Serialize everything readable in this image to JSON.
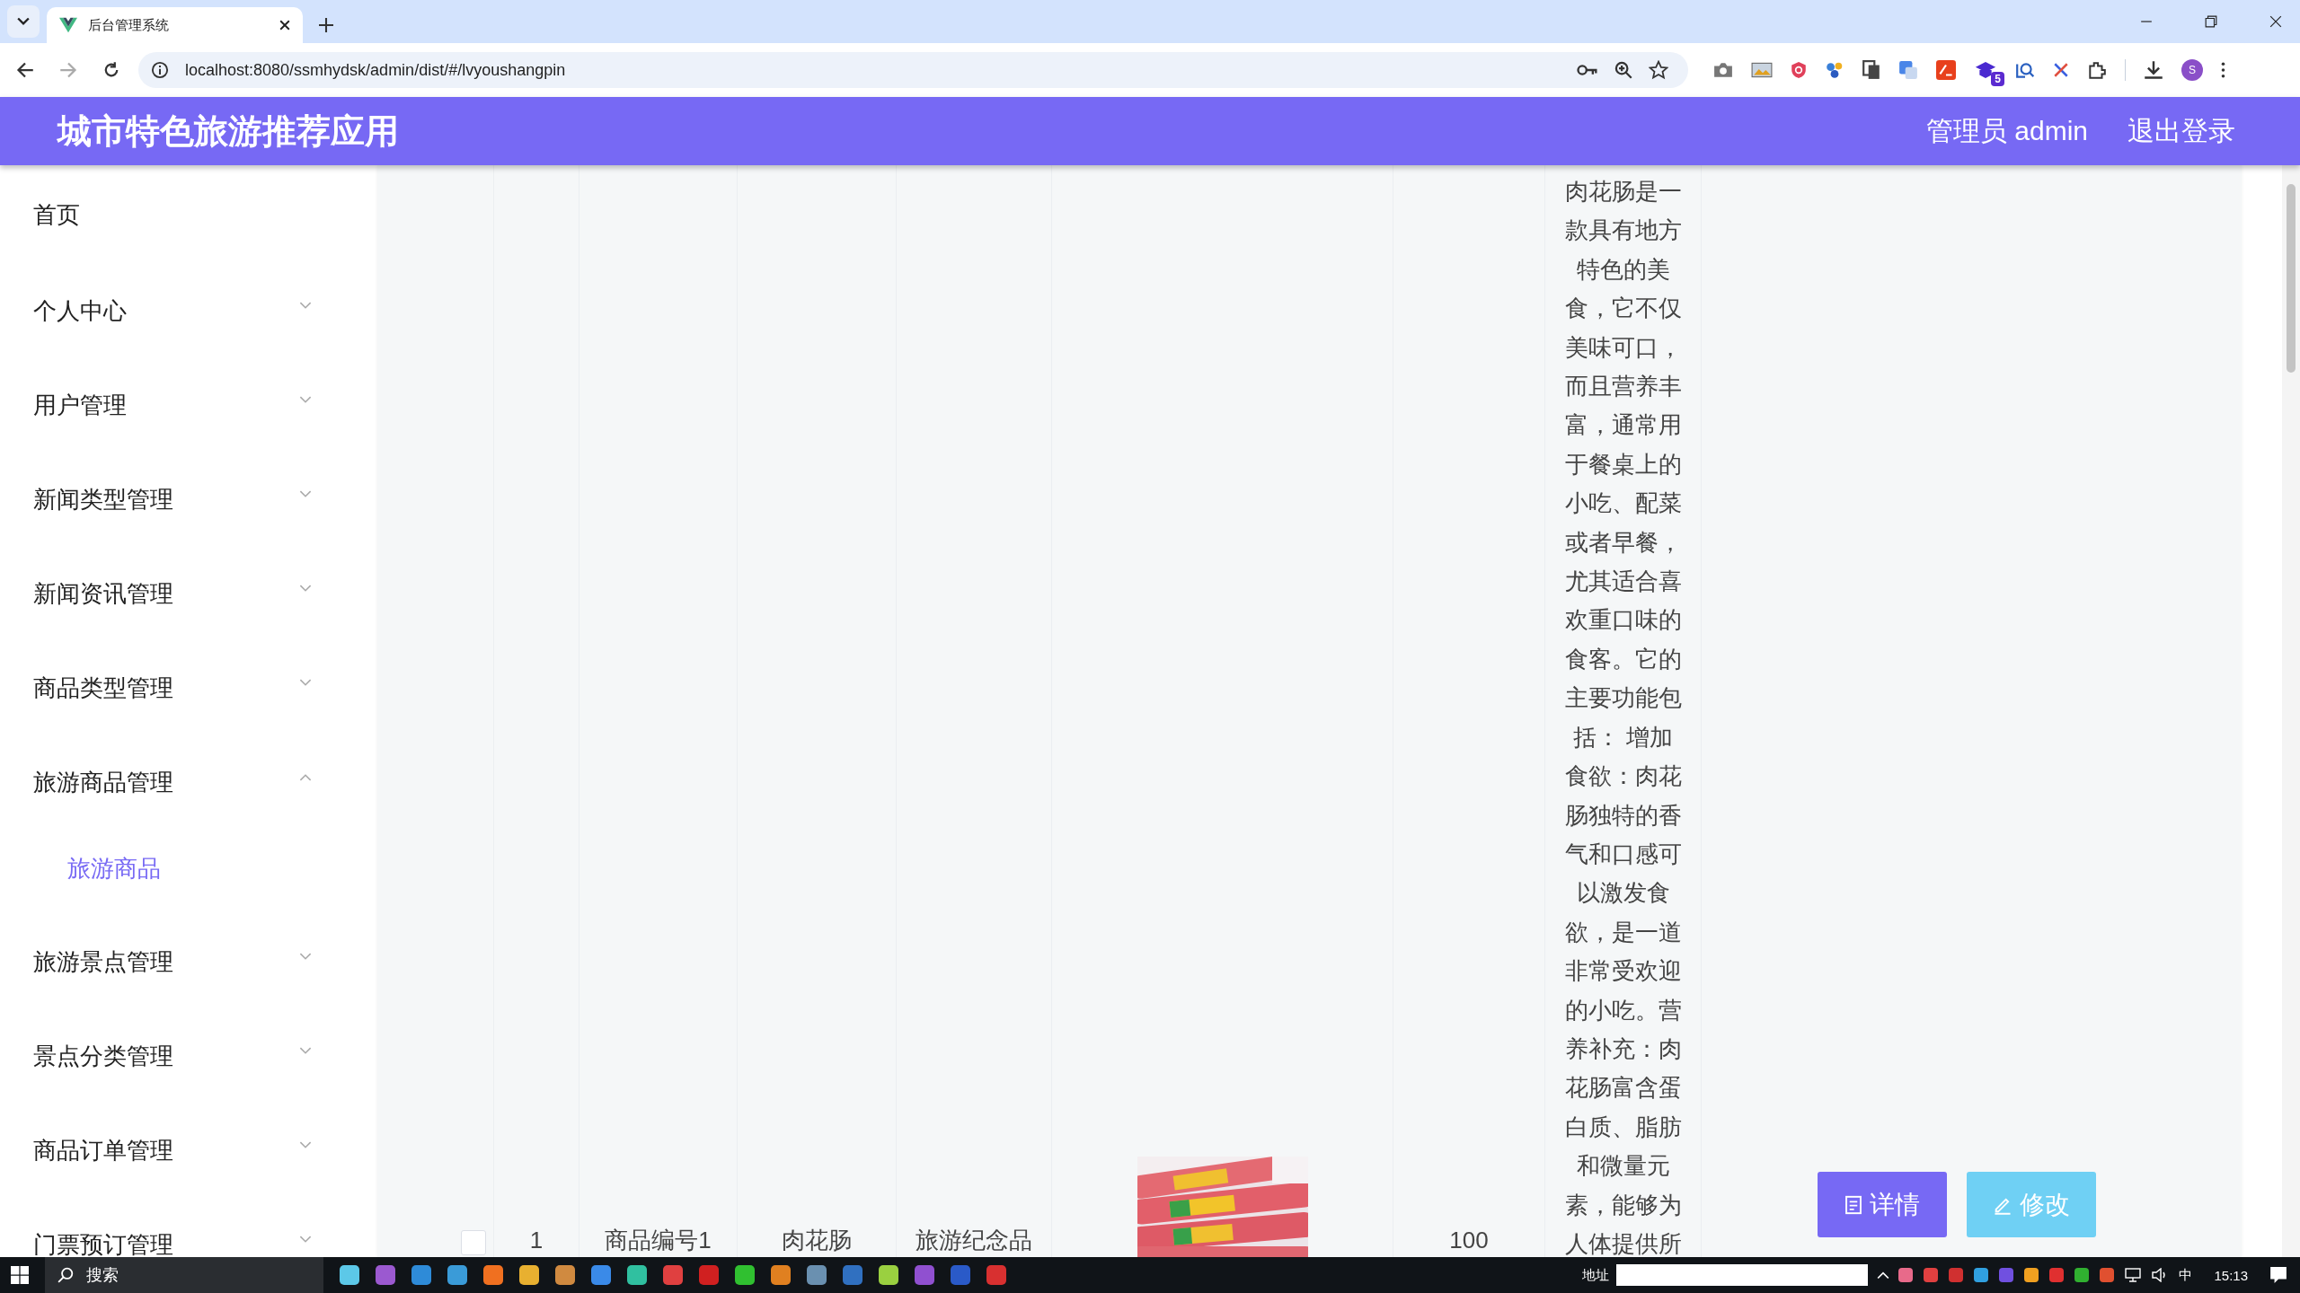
{
  "browser": {
    "tab": {
      "title": "后台管理系统"
    },
    "url": "localhost:8080/ssmhydsk/admin/dist/#/lvyoushangpin",
    "extension_badge": "5",
    "profile_initial": "S"
  },
  "header": {
    "title": "城市特色旅游推荐应用",
    "user": "管理员 admin",
    "logout": "退出登录"
  },
  "sidebar": {
    "items": [
      {
        "label": "首页",
        "kind": "link"
      },
      {
        "label": "个人中心",
        "kind": "group",
        "expanded": false
      },
      {
        "label": "用户管理",
        "kind": "group",
        "expanded": false
      },
      {
        "label": "新闻类型管理",
        "kind": "group",
        "expanded": false
      },
      {
        "label": "新闻资讯管理",
        "kind": "group",
        "expanded": false
      },
      {
        "label": "商品类型管理",
        "kind": "group",
        "expanded": false
      },
      {
        "label": "旅游商品管理",
        "kind": "group",
        "expanded": true,
        "children": [
          {
            "label": "旅游商品",
            "selected": true
          }
        ]
      },
      {
        "label": "旅游景点管理",
        "kind": "group",
        "expanded": false
      },
      {
        "label": "景点分类管理",
        "kind": "group",
        "expanded": false
      },
      {
        "label": "商品订单管理",
        "kind": "group",
        "expanded": false
      },
      {
        "label": "门票预订管理",
        "kind": "group",
        "expanded": false
      }
    ]
  },
  "table": {
    "rows": [
      {
        "checked": false,
        "cells": [
          {
            "kind": "text",
            "text": "1"
          },
          {
            "kind": "text",
            "text": "商品编号1"
          },
          {
            "kind": "text",
            "text": "肉花肠"
          },
          {
            "kind": "text",
            "text": "旅游纪念品"
          },
          {
            "kind": "picture"
          },
          {
            "kind": "text",
            "text": "100"
          },
          {
            "kind": "long",
            "text": "肉花肠是一款具有地方特色的美食，它不仅美味可口，而且营养丰富，通常用于餐桌上的小吃、配菜或者早餐，尤其适合喜欢重口味的食客。它的主要功能包括： 增加食欲：肉花肠独特的香气和口感可以激发食欲，是一道非常受欢迎的小吃。营养补充：肉花肠富含蛋白质、脂肪和微量元素，能够为人体提供所"
          }
        ],
        "buttons": [
          {
            "kind": "detail",
            "label": "详情"
          },
          {
            "kind": "edit",
            "label": "修改"
          }
        ]
      }
    ]
  },
  "taskbar": {
    "search": "搜索",
    "address_label": "地址",
    "ime": "中",
    "time": "15:13"
  }
}
